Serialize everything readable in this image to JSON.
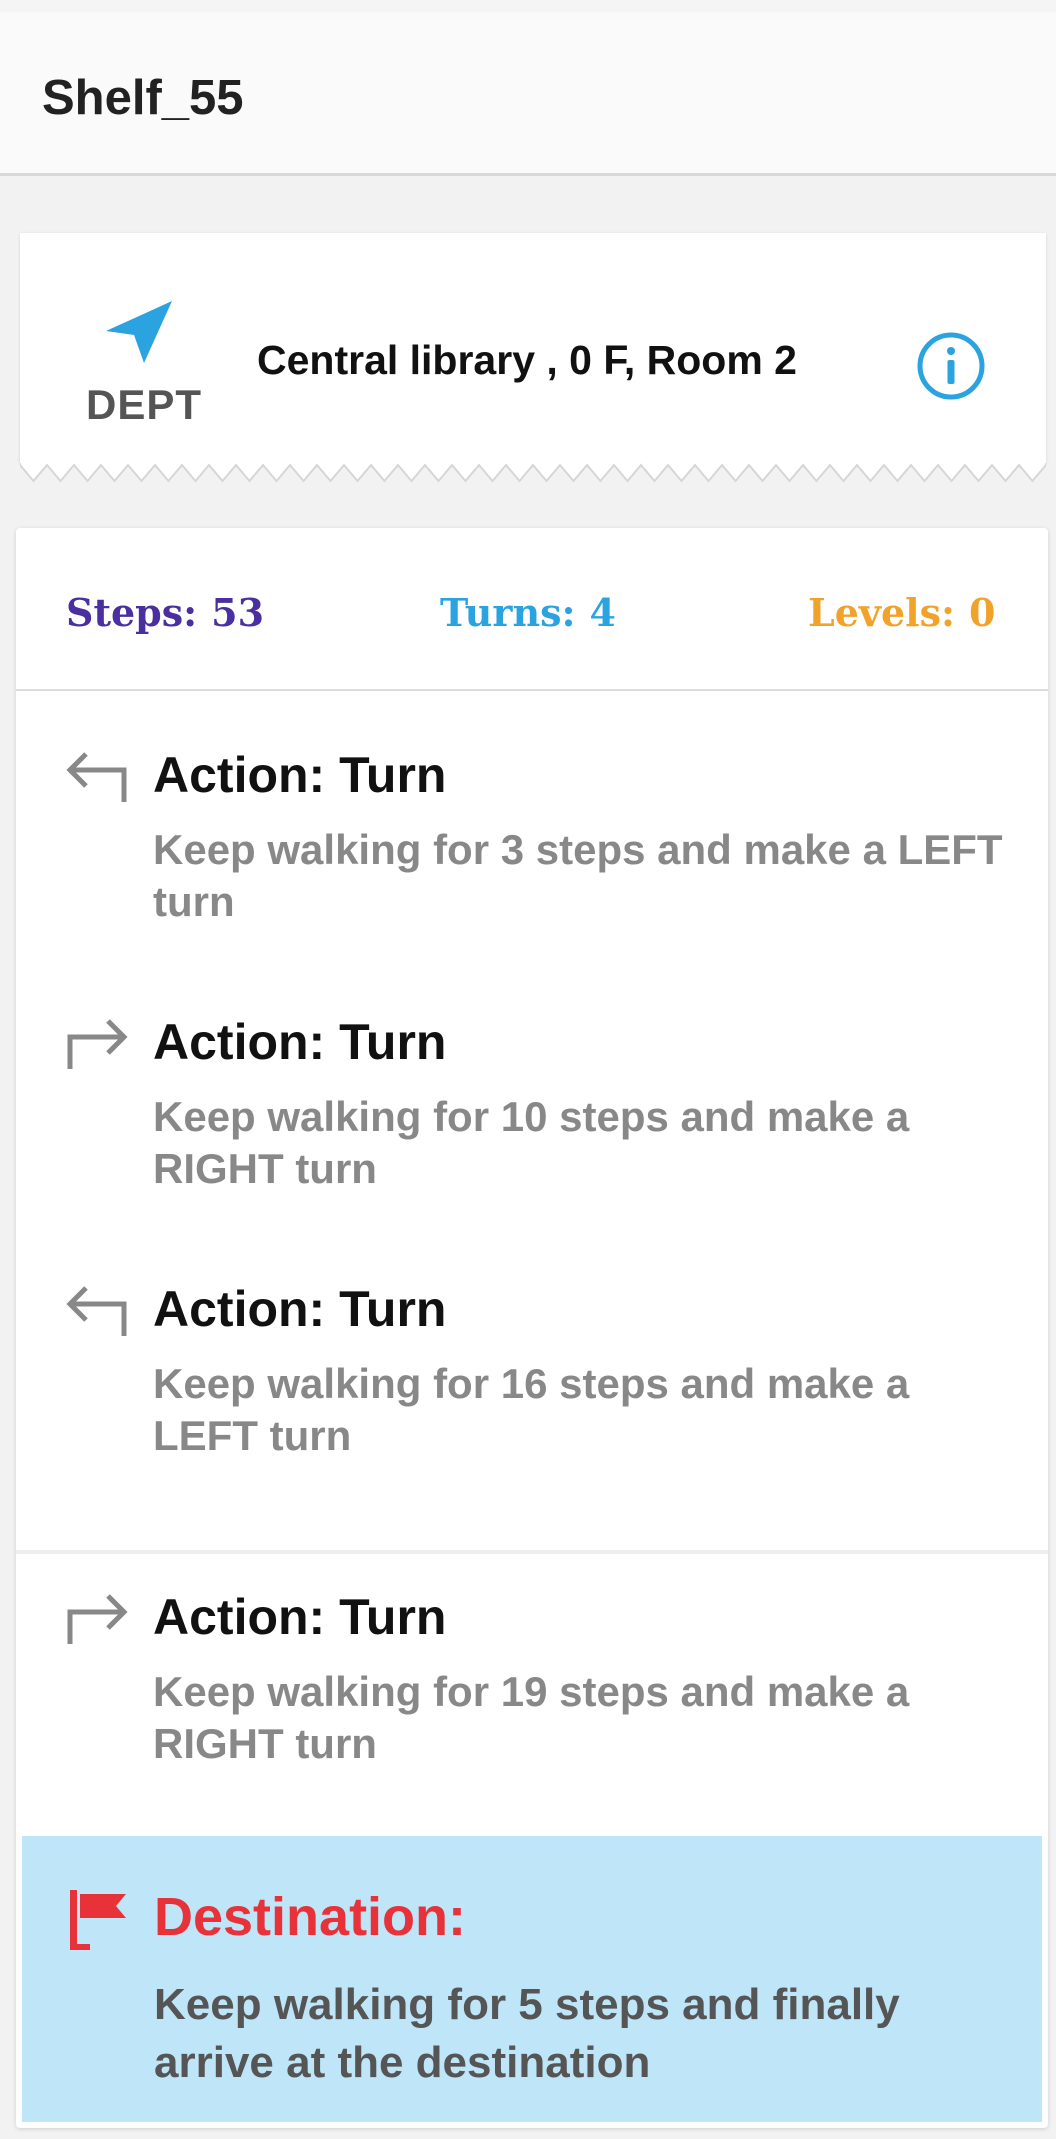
{
  "header": {
    "title": "Shelf_55"
  },
  "ticket": {
    "dept_label": "DEPT",
    "location": "Central library , 0 F, Room 2"
  },
  "stats": {
    "steps_label": "Steps:",
    "steps_value": "53",
    "turns_label": "Turns:",
    "turns_value": "4",
    "levels_label": "Levels:",
    "levels_value": "0"
  },
  "steps": [
    {
      "action": "Action: Turn",
      "description": "Keep walking for 3 steps and make a LEFT turn",
      "icon": "turn-left-icon"
    },
    {
      "action": "Action: Turn",
      "description": "Keep walking for 10 steps and make a RIGHT turn",
      "icon": "turn-right-icon"
    },
    {
      "action": "Action: Turn",
      "description": "Keep walking for 16 steps and make a LEFT turn",
      "icon": "turn-left-icon"
    },
    {
      "action": "Action: Turn",
      "description": "Keep walking for 19 steps and make a RIGHT turn",
      "icon": "turn-right-icon"
    }
  ],
  "destination": {
    "title": "Destination:",
    "description": "Keep walking for 5 steps and finally arrive at the destination",
    "icon": "flag-icon"
  },
  "colors": {
    "steps": "#4a2fa0",
    "turns": "#2ba3e0",
    "levels": "#f0a22a",
    "destination_bg": "#bfe5f8",
    "destination_title": "#e8323a",
    "nav_icon": "#2ba3e0"
  }
}
